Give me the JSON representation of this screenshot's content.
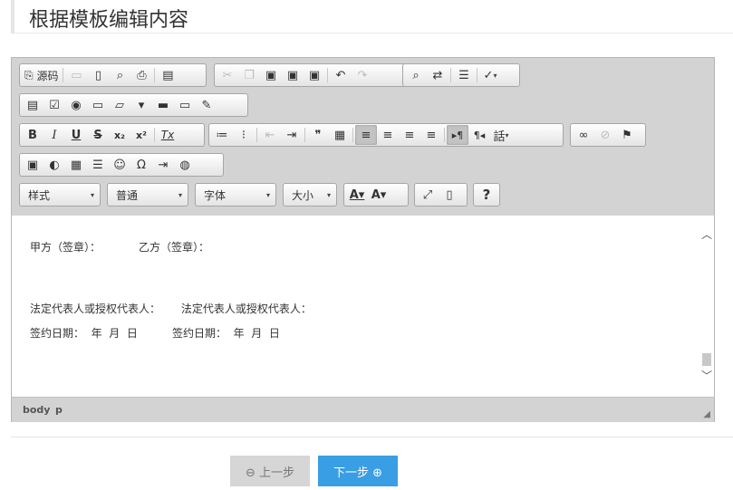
{
  "page": {
    "title": "根据模板编辑内容"
  },
  "toolbar": {
    "source_label": "源码",
    "combos": {
      "style": "样式",
      "format": "普通",
      "font": "字体",
      "size": "大小"
    },
    "row1": [
      {
        "name": "source-icon",
        "glyph": "⎘"
      },
      {
        "name": "save-icon",
        "glyph": "▭",
        "dis": true
      },
      {
        "name": "new-page-icon",
        "glyph": "▯"
      },
      {
        "name": "preview-icon",
        "glyph": "⌕"
      },
      {
        "name": "print-icon",
        "glyph": "⎙"
      },
      {
        "name": "templates-icon",
        "glyph": "▤"
      },
      {
        "name": "cut-icon",
        "glyph": "✂",
        "dis": true
      },
      {
        "name": "copy-icon",
        "glyph": "❐",
        "dis": true
      },
      {
        "name": "paste-icon",
        "glyph": "▣"
      },
      {
        "name": "paste-text-icon",
        "glyph": "▣"
      },
      {
        "name": "paste-word-icon",
        "glyph": "▣"
      },
      {
        "name": "undo-icon",
        "glyph": "↶"
      },
      {
        "name": "redo-icon",
        "glyph": "↷",
        "dis": true
      },
      {
        "name": "find-icon",
        "glyph": "🔍"
      },
      {
        "name": "replace-icon",
        "glyph": "⇄"
      },
      {
        "name": "select-all-icon",
        "glyph": "☰"
      },
      {
        "name": "spellcheck-icon",
        "glyph": "✓"
      }
    ],
    "row2": [
      {
        "name": "form-icon",
        "glyph": "▤"
      },
      {
        "name": "checkbox-icon",
        "glyph": "☑"
      },
      {
        "name": "radio-icon",
        "glyph": "◉"
      },
      {
        "name": "textfield-icon",
        "glyph": "▭"
      },
      {
        "name": "textarea-icon",
        "glyph": "▱"
      },
      {
        "name": "select-icon",
        "glyph": "▾"
      },
      {
        "name": "button-icon",
        "glyph": "▬"
      },
      {
        "name": "image-button-icon",
        "glyph": "▭"
      },
      {
        "name": "hidden-field-icon",
        "glyph": "✎"
      }
    ],
    "row3": [
      {
        "name": "bold-icon",
        "glyph": "B"
      },
      {
        "name": "italic-icon",
        "glyph": "I"
      },
      {
        "name": "underline-icon",
        "glyph": "U"
      },
      {
        "name": "strike-icon",
        "glyph": "S"
      },
      {
        "name": "subscript-icon",
        "glyph": "x₂"
      },
      {
        "name": "superscript-icon",
        "glyph": "x²"
      },
      {
        "name": "remove-format-icon",
        "glyph": "Tx"
      },
      {
        "name": "numbered-list-icon",
        "glyph": "≔"
      },
      {
        "name": "bulleted-list-icon",
        "glyph": "⁝"
      },
      {
        "name": "outdent-icon",
        "glyph": "⇤",
        "dis": true
      },
      {
        "name": "indent-icon",
        "glyph": "⇥"
      },
      {
        "name": "blockquote-icon",
        "glyph": "❞"
      },
      {
        "name": "div-icon",
        "glyph": "▦"
      },
      {
        "name": "align-left-icon",
        "glyph": "≡",
        "active": true
      },
      {
        "name": "align-center-icon",
        "glyph": "≡"
      },
      {
        "name": "align-right-icon",
        "glyph": "≡"
      },
      {
        "name": "justify-icon",
        "glyph": "≡"
      },
      {
        "name": "ltr-icon",
        "glyph": "▸¶",
        "active": true
      },
      {
        "name": "rtl-icon",
        "glyph": "¶◂"
      },
      {
        "name": "language-icon",
        "glyph": "話"
      },
      {
        "name": "link-icon",
        "glyph": "∞"
      },
      {
        "name": "unlink-icon",
        "glyph": "⊘",
        "dis": true
      },
      {
        "name": "anchor-icon",
        "glyph": "⚑"
      }
    ],
    "row4": [
      {
        "name": "image-icon",
        "glyph": "▣"
      },
      {
        "name": "flash-icon",
        "glyph": "◐"
      },
      {
        "name": "table-icon",
        "glyph": "▦"
      },
      {
        "name": "horizontal-rule-icon",
        "glyph": "☰"
      },
      {
        "name": "smiley-icon",
        "glyph": "☺"
      },
      {
        "name": "special-char-icon",
        "glyph": "Ω"
      },
      {
        "name": "page-break-icon",
        "glyph": "⇥"
      },
      {
        "name": "iframe-icon",
        "glyph": "◍"
      }
    ],
    "row5": [
      {
        "name": "text-color-icon",
        "glyph": "A▾"
      },
      {
        "name": "bg-color-icon",
        "glyph": "A▾"
      },
      {
        "name": "maximize-icon",
        "glyph": "⤢"
      },
      {
        "name": "show-blocks-icon",
        "glyph": "▯"
      },
      {
        "name": "about-icon",
        "glyph": "?"
      }
    ]
  },
  "content": {
    "line1": "甲方（签章）：           乙方（签章）：",
    "line2": "法定代表人或授权代表人：      法定代表人或授权代表人：",
    "line3": "签约日期：  年  月  日          签约日期：  年  月  日"
  },
  "pathbar": {
    "body": "body",
    "p": "p"
  },
  "nav": {
    "prev": "⊖ 上一步",
    "next": "下一步 ⊕"
  }
}
